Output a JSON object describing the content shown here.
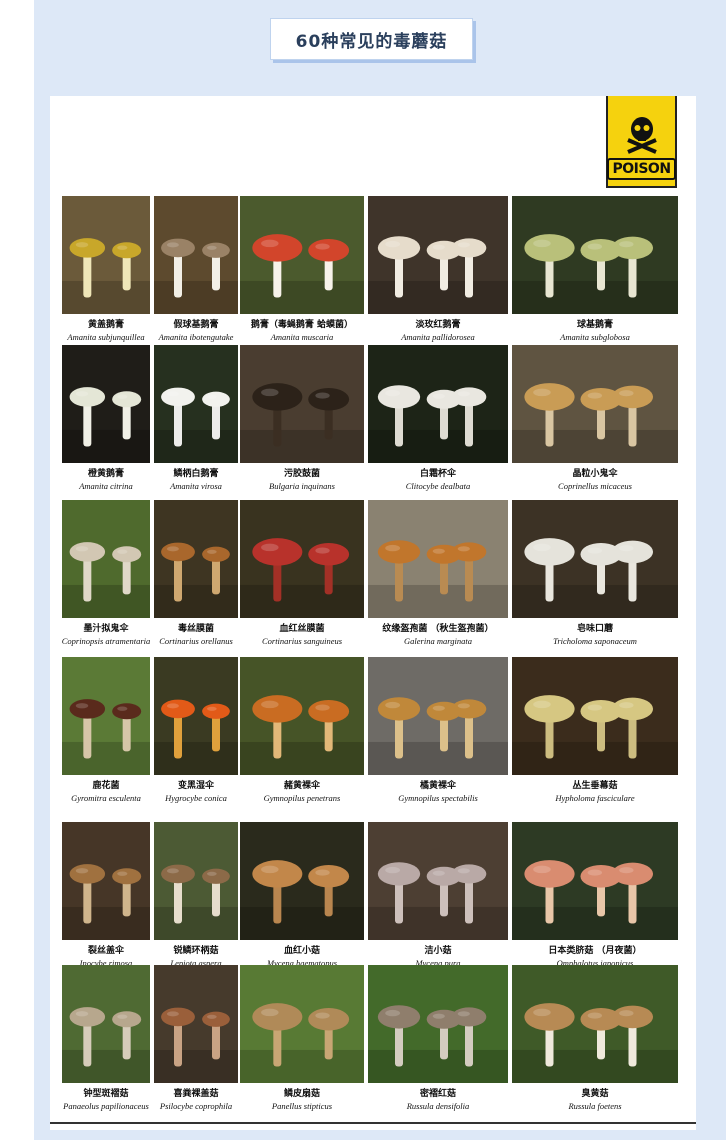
{
  "title": "60种常见的毒蘑菇",
  "poison_label": "POISON",
  "rows": [
    [
      {
        "cn": "黄盖鹅膏",
        "latin": "Amanita subjunquillea",
        "bg": "#6b5a3a",
        "cap": "#c8a72a",
        "stem": "#efe6b8"
      },
      {
        "cn": "假球基鹅膏",
        "latin": "Amanita ibotengutake",
        "bg": "#5d4a2e",
        "cap": "#9a8266",
        "stem": "#f2efe6"
      },
      {
        "cn": "鹅膏（毒蝇鹅膏 蛤蟆菌）",
        "latin": "Amanita muscaria",
        "bg": "#4b5a2d",
        "cap": "#d2452b",
        "stem": "#f7f2ea"
      },
      {
        "cn": "淡玫红鹅膏",
        "latin": "Amanita pallidorosea",
        "bg": "#3f342a",
        "cap": "#e6dccb",
        "stem": "#f1ece2"
      },
      {
        "cn": "球基鹅膏",
        "latin": "Amanita subglobosa",
        "bg": "#2f3a22",
        "cap": "#b9c07a",
        "stem": "#e8e6d2"
      }
    ],
    [
      {
        "cn": "橙黄鹅膏",
        "latin": "Amanita citrina",
        "bg": "#1f1d18",
        "cap": "#e4e6d6",
        "stem": "#f0f0e6"
      },
      {
        "cn": "鳞柄白鹅膏",
        "latin": "Amanita virosa",
        "bg": "#26301f",
        "cap": "#f2f2ee",
        "stem": "#ececea"
      },
      {
        "cn": "污胶鼓菌",
        "latin": "Bulgaria inquinans",
        "bg": "#4a3d30",
        "cap": "#2c2219",
        "stem": "#3b2e22"
      },
      {
        "cn": "白霜杯伞",
        "latin": "Clitocybe dealbata",
        "bg": "#1d2417",
        "cap": "#e9e7e0",
        "stem": "#dedbd2"
      },
      {
        "cn": "晶粒小鬼伞",
        "latin": "Coprinellus micaceus",
        "bg": "#5f5441",
        "cap": "#c99c55",
        "stem": "#d9c6a2"
      }
    ],
    [
      {
        "cn": "墨汁拟鬼伞",
        "latin": "Coprinopsis atramentaria",
        "bg": "#4f6a2d",
        "cap": "#d2c7b3",
        "stem": "#e0d8c8"
      },
      {
        "cn": "毒丝膜菌",
        "latin": "Cortinarius orellanus",
        "bg": "#3e3522",
        "cap": "#a9672c",
        "stem": "#cfa870"
      },
      {
        "cn": "血红丝膜菌",
        "latin": "Cortinarius sanguineus",
        "bg": "#39331f",
        "cap": "#b8322b",
        "stem": "#a33026"
      },
      {
        "cn": "纹缘盔孢菌 （秋生盔孢菌）",
        "latin": "Galerina marginata",
        "bg": "#8a8271",
        "cap": "#c1762c",
        "stem": "#b98b52"
      },
      {
        "cn": "皂味口蘑",
        "latin": "Tricholoma saponaceum",
        "bg": "#3c3225",
        "cap": "#e5e3db",
        "stem": "#e9e6de"
      }
    ],
    [
      {
        "cn": "鹿花菌",
        "latin": "Gyromitra esculenta",
        "bg": "#5b7a36",
        "cap": "#5a2a1c",
        "stem": "#d6c6a8"
      },
      {
        "cn": "变黑湿伞",
        "latin": "Hygrocybe conica",
        "bg": "#3a3a22",
        "cap": "#e25a18",
        "stem": "#e0a13c"
      },
      {
        "cn": "赭黄裸伞",
        "latin": "Gymnopilus penetrans",
        "bg": "#465427",
        "cap": "#c96c22",
        "stem": "#e2b878"
      },
      {
        "cn": "橘黄裸伞",
        "latin": "Gymnopilus spectabilis",
        "bg": "#6e6b66",
        "cap": "#c0883a",
        "stem": "#dcc08a"
      },
      {
        "cn": "丛生垂幕菇",
        "latin": "Hypholoma fasciculare",
        "bg": "#3b2c1c",
        "cap": "#d6c782",
        "stem": "#cdbd80"
      }
    ],
    [
      {
        "cn": "裂丝盖伞",
        "latin": "Inocybe rimosa",
        "bg": "#463627",
        "cap": "#a0713f",
        "stem": "#d0b58c"
      },
      {
        "cn": "锐鳞环柄菇",
        "latin": "Lepiota aspera",
        "bg": "#4c5a34",
        "cap": "#8c6a48",
        "stem": "#e6ddcc"
      },
      {
        "cn": "血红小菇",
        "latin": "Mycena haematopus",
        "bg": "#2a2a1c",
        "cap": "#c2874a",
        "stem": "#b9864f"
      },
      {
        "cn": "洁小菇",
        "latin": "Mycena pura",
        "bg": "#4d3f33",
        "cap": "#b9a9a6",
        "stem": "#cdc0bb"
      },
      {
        "cn": "日本类脐菇 （月夜菌）",
        "latin": "Omphalotus japonicus",
        "bg": "#2d3a24",
        "cap": "#d98c70",
        "stem": "#e8c6a8"
      }
    ],
    [
      {
        "cn": "钟型斑褶菇",
        "latin": "Panaeolus papilionaceus",
        "bg": "#4f6a33",
        "cap": "#b7a78d",
        "stem": "#d6ccba"
      },
      {
        "cn": "喜粪裸盖菇",
        "latin": "Psilocybe coprophila",
        "bg": "#463a2c",
        "cap": "#9a5f3a",
        "stem": "#c9a384"
      },
      {
        "cn": "鳞皮扇菇",
        "latin": "Panellus stipticus",
        "bg": "#587a34",
        "cap": "#b08a58",
        "stem": "#c8a674"
      },
      {
        "cn": "密褶红菇",
        "latin": "Russula densifolia",
        "bg": "#436a2a",
        "cap": "#8f7e6c",
        "stem": "#d4ccc0"
      },
      {
        "cn": "臭黄菇",
        "latin": "Russula foetens",
        "bg": "#3f5a28",
        "cap": "#b78a54",
        "stem": "#efe9dc"
      }
    ]
  ]
}
